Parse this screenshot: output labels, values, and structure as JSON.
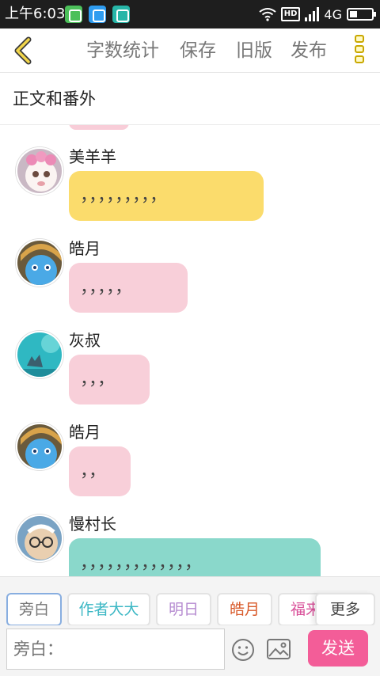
{
  "status_bar": {
    "time": "上午6:03",
    "hd": "HD",
    "network": "4G"
  },
  "toolbar": {
    "word_count": "字数统计",
    "save": "保存",
    "old_version": "旧版",
    "publish": "发布"
  },
  "chapter": {
    "title": "正文和番外"
  },
  "messages": [
    {
      "name": "美羊羊",
      "text": "，，，，，，，，，",
      "color": "#fbdc6c"
    },
    {
      "name": "皓月",
      "text": "，，，，，",
      "color": "#f8cfd9"
    },
    {
      "name": "灰叔",
      "text": "，，，",
      "color": "#f8cfd9"
    },
    {
      "name": "皓月",
      "text": "，，",
      "color": "#f8cfd9"
    },
    {
      "name": "慢村长",
      "text": "，，，，，，，，，，，，，",
      "color": "#8ad8cb"
    }
  ],
  "roles": [
    {
      "label": "旁白",
      "color": "#777777"
    },
    {
      "label": "作者大大",
      "color": "#3bb7c4"
    },
    {
      "label": "明日",
      "color": "#b58ad0"
    },
    {
      "label": "皓月",
      "color": "#d85a2a"
    },
    {
      "label": "福来",
      "color": "#d9519a"
    }
  ],
  "more_label": "更多",
  "input": {
    "placeholder": "旁白："
  },
  "send_label": "发送",
  "icons": [
    "back-chevron-icon",
    "menu-icon",
    "emoji-icon",
    "image-icon",
    "wifi-icon",
    "signal-icon",
    "battery-icon"
  ]
}
